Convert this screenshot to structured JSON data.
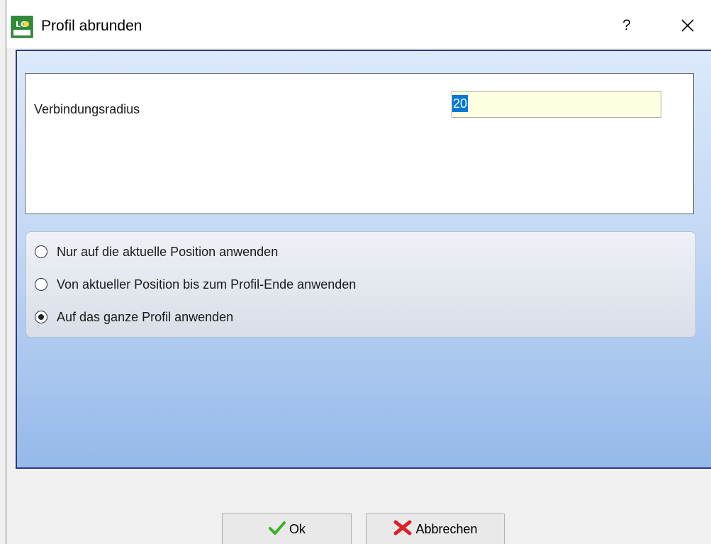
{
  "window": {
    "title": "Profil abrunden",
    "help_label": "?",
    "icons": {
      "app": "app-icon",
      "close": "close-icon"
    }
  },
  "input_panel": {
    "field_label": "Verbindungsradius",
    "field_value": "20"
  },
  "apply_options": {
    "items": [
      {
        "label": "Nur auf die aktuelle Position anwenden",
        "checked": false
      },
      {
        "label": "Von aktueller Position bis zum Profil-Ende anwenden",
        "checked": false
      },
      {
        "label": "Auf das ganze Profil anwenden",
        "checked": true
      }
    ]
  },
  "buttons": {
    "ok_label": "Ok",
    "cancel_label": "Abbrechen",
    "ok_icon": "checkmark-icon",
    "cancel_icon": "cross-icon"
  },
  "colors": {
    "client_gradient_top": "#dbe9fb",
    "client_gradient_bottom": "#95b9ea",
    "client_border": "#2d3a7a",
    "input_background": "#ffffe1",
    "selection": "#0078d7",
    "ok_icon": "#3fae2a",
    "cancel_icon": "#d8222a"
  }
}
